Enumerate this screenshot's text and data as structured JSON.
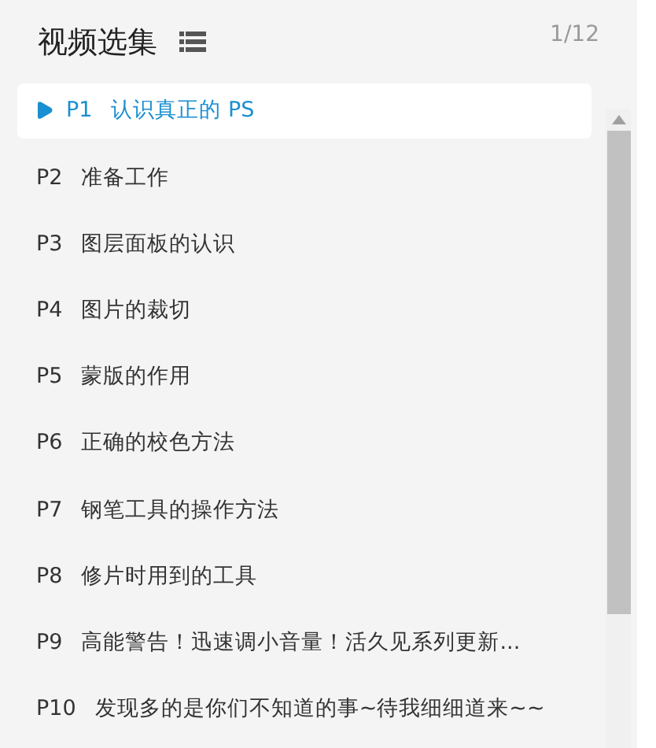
{
  "header": {
    "title": "视频选集",
    "counter": "1/12"
  },
  "episodes": [
    {
      "number": "P1",
      "title": "认识真正的 PS",
      "selected": true
    },
    {
      "number": "P2",
      "title": "准备工作",
      "selected": false
    },
    {
      "number": "P3",
      "title": "图层面板的认识",
      "selected": false
    },
    {
      "number": "P4",
      "title": "图片的裁切",
      "selected": false
    },
    {
      "number": "P5",
      "title": "蒙版的作用",
      "selected": false
    },
    {
      "number": "P6",
      "title": "正确的校色方法",
      "selected": false
    },
    {
      "number": "P7",
      "title": "钢笔工具的操作方法",
      "selected": false
    },
    {
      "number": "P8",
      "title": "修片时用到的工具",
      "selected": false
    },
    {
      "number": "P9",
      "title": "高能警告！迅速调小音量！活久见系列更新...",
      "selected": false
    },
    {
      "number": "P10",
      "title": "发现多的是你们不知道的事~待我细细道来~~",
      "selected": false
    }
  ]
}
